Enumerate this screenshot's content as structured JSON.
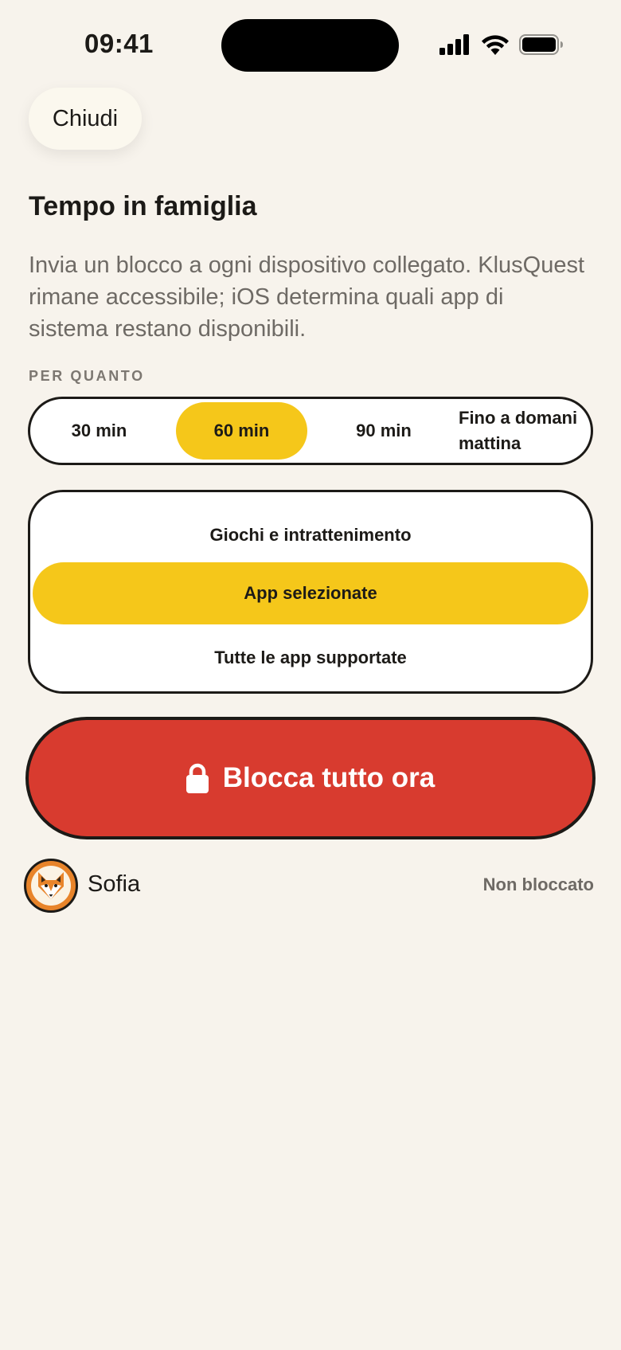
{
  "status_bar": {
    "time": "09:41",
    "icons": [
      "cellular-signal-icon",
      "wifi-icon",
      "battery-icon"
    ]
  },
  "close_button": {
    "label": "Chiudi"
  },
  "header": {
    "title": "Tempo in famiglia",
    "description": "Invia un blocco a ogni dispositivo collegato. KlusQuest rimane accessibile; iOS determina quali app di sistema restano disponibili."
  },
  "duration": {
    "section_label": "PER QUANTO",
    "options": [
      "30 min",
      "60 min",
      "90 min",
      "Fino a domani mattina"
    ],
    "selected": "60 min"
  },
  "scope": {
    "options": [
      "Giochi e intrattenimento",
      "App selezionate",
      "Tutte le app supportate"
    ],
    "selected": "App selezionate"
  },
  "block_button": {
    "label": "Blocca tutto ora",
    "icon": "lock-icon"
  },
  "children": [
    {
      "name": "Sofia",
      "avatar": "fox-icon",
      "status": "Non bloccato"
    }
  ],
  "colors": {
    "background": "#f7f3ec",
    "accent_yellow": "#f5c71a",
    "danger_red": "#d83b2f",
    "ink": "#1c1a17",
    "muted_text": "#6e6a65"
  }
}
